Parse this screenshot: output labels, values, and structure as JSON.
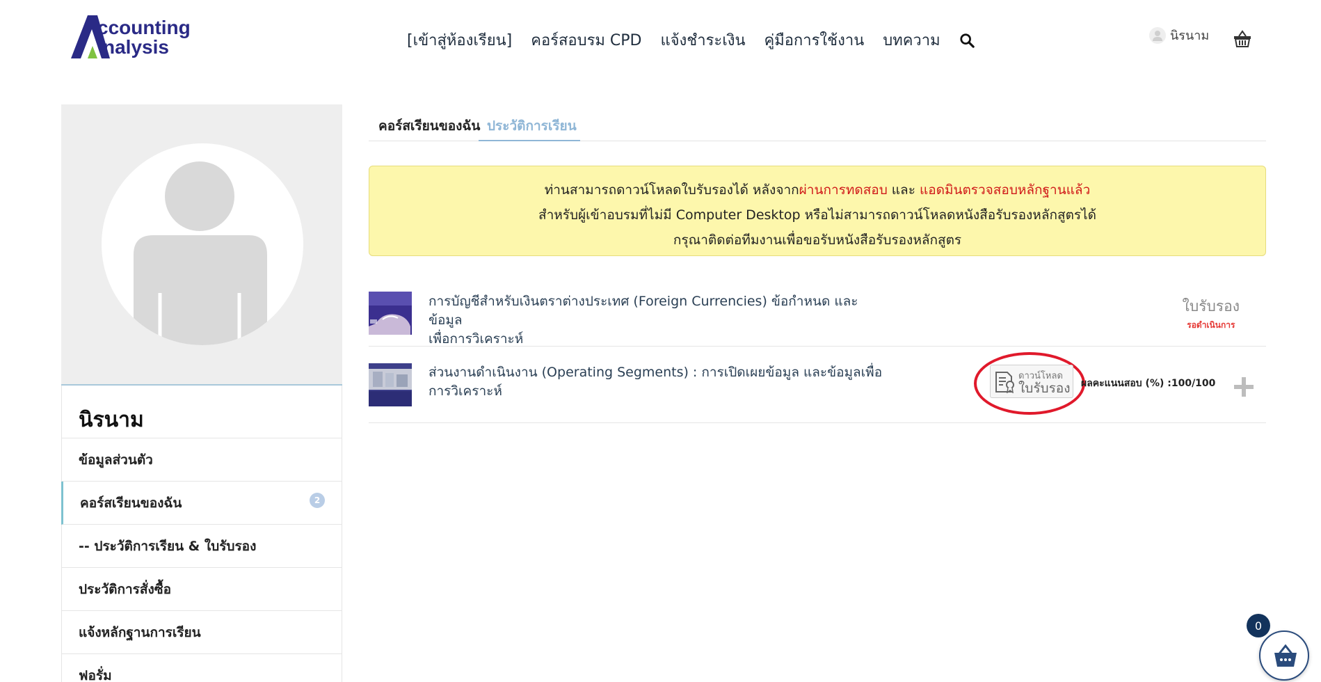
{
  "header": {
    "logo_text_line1": "ccounting",
    "logo_text_line2": "nalysis",
    "nav": [
      "[เข้าสู่ห้องเรียน]",
      "คอร์สอบรม CPD",
      "แจ้งชำระเงิน",
      "คู่มือการใช้งาน",
      "บทความ"
    ],
    "user_name": "นิรนาม",
    "icons": [
      "search-icon",
      "user-icon",
      "cart-icon"
    ]
  },
  "sidebar": {
    "name": "นิรนาม",
    "items": [
      {
        "label": "ข้อมูลส่วนตัว"
      },
      {
        "label": "คอร์สเรียนของฉัน",
        "badge": "2"
      },
      {
        "label": "-- ประวัติการเรียน & ใบรับรอง"
      },
      {
        "label": "ประวัติการสั่งซื้อ"
      },
      {
        "label": "แจ้งหลักฐานการเรียน"
      },
      {
        "label": "ฟอรั่ม"
      }
    ]
  },
  "tabs": [
    {
      "label": "คอร์สเรียนของฉัน"
    },
    {
      "label": "ประวัติการเรียน"
    }
  ],
  "notice": {
    "line1_a": "ท่านสามารถดาวน์โหลดใบรับรองได้ หลังจาก",
    "line1_b": "ผ่านการทดสอบ",
    "line1_c": " และ ",
    "line1_d": "แอดมินตรวจสอบหลักฐานแล้ว",
    "line2": "สำหรับผู้เข้าอบรมที่ไม่มี Computer Desktop หรือไม่สามารถดาวน์โหลดหนังสือรับรองหลักสูตรได้",
    "line3": "กรุณาติดต่อทีมงานเพื่อขอรับหนังสือรับรองหลักสูตร"
  },
  "courses": [
    {
      "title_line1": "การบัญชีสำหรับเงินตราต่างประเทศ (Foreign Currencies) ข้อกำหนด และข้อมูล",
      "title_line2": "เพื่อการวิเคราะห์",
      "cert_label": "ใบรับรอง",
      "cert_status": "รอดำเนินการ"
    },
    {
      "title_line1": "ส่วนงานดำเนินงาน (Operating Segments) : การเปิดเผยข้อมูล และข้อมูลเพื่อ",
      "title_line2": "การวิเคราะห์",
      "download_small": "ดาวน์โหลด",
      "download_big": "ใบรับรอง",
      "score": "ผลคะแนนสอบ (%) :100/100"
    }
  ],
  "floating_cart": {
    "count": "0"
  },
  "colors": {
    "brand_blue": "#2a2a86",
    "brand_green": "#7fc241",
    "notice_bg": "#fdf7ac",
    "alert_red": "#d01a1a",
    "tab_active": "#8fb6d6"
  }
}
